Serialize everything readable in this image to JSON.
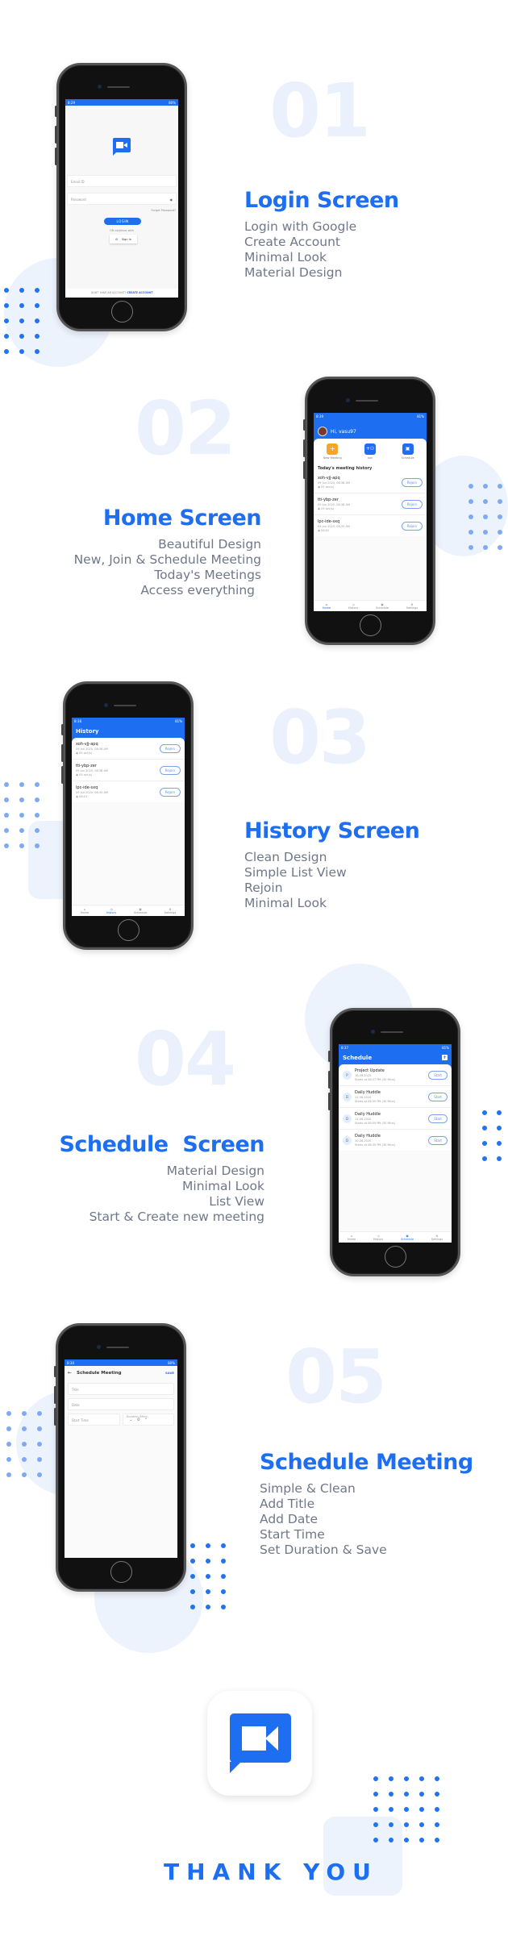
{
  "brand": {
    "accent": "#1d6ef0",
    "soft": "#edf3fd",
    "orange": "#f5a623"
  },
  "sections": [
    {
      "number": "01",
      "title": "Login Screen",
      "features": [
        "Login with Google",
        "Create Account",
        "Minimal Look",
        "Material Design"
      ]
    },
    {
      "number": "02",
      "title": "Home Screen",
      "features": [
        "Beautiful Design",
        "New, Join & Schedule Meeting",
        "Today's Meetings",
        "Access everything"
      ]
    },
    {
      "number": "03",
      "title": "History Screen",
      "features": [
        "Clean Design",
        "Simple List View",
        "Rejoin",
        "Minimal Look"
      ]
    },
    {
      "number": "04",
      "title": "Schedule  Screen",
      "features": [
        "Material Design",
        "Minimal Look",
        "List View",
        "Start & Create new meeting"
      ]
    },
    {
      "number": "05",
      "title": "Schedule Meeting",
      "features": [
        "Simple & Clean",
        "Add Title",
        "Add Date",
        "Start Time",
        "Set Duration & Save"
      ]
    }
  ],
  "login": {
    "status_time": "8:29",
    "status_right": "80% ",
    "email_placeholder": "Email ID",
    "password_placeholder": "Password",
    "forgot": "Forgot Password?",
    "login_button": "LOGIN",
    "or_text": "OR continue with",
    "google_button": "Sign In",
    "footer_text": "DON'T HAVE AN ACCOUNT?",
    "footer_link": "CREATE ACCOUNT",
    "icons": {
      "logo": "video-chat-icon",
      "eye": "eye-icon",
      "google": "google-icon"
    }
  },
  "home": {
    "status_time": "8:39",
    "status_right": "81% ",
    "greeting": "Hi, vasu97",
    "actions": [
      {
        "label": "New Meeting",
        "icon": "plus-box-icon",
        "color": "#f5a623"
      },
      {
        "label": "Join",
        "icon": "join-people-icon",
        "color": "#1d6ef0"
      },
      {
        "label": "Schedule",
        "icon": "calendar-icon",
        "color": "#1d6ef0"
      }
    ],
    "history_title": "Today's meeting history",
    "meetings": [
      {
        "code": "xoh-vjj-apq",
        "date": "09 Jun 2020, 08:38 AM",
        "duration": "05 sec(s)",
        "button": "Rejoin"
      },
      {
        "code": "tti-ybp-zer",
        "date": "09 Jun 2020, 08:38 AM",
        "duration": "05 sec(s)",
        "button": "Rejoin"
      },
      {
        "code": "lpc-ide-sxq",
        "date": "09 Jun 2020, 08:35 AM",
        "duration": "08:01",
        "button": "Rejoin"
      }
    ]
  },
  "history": {
    "status_time": "8:38",
    "status_right": "81% ",
    "title": "History",
    "meetings": [
      {
        "code": "xoh-vjj-apq",
        "date": "09 Jun 2020, 08:38 AM",
        "duration": "05 sec(s)",
        "button": "Rejoin"
      },
      {
        "code": "tti-ybp-zer",
        "date": "09 Jun 2020, 08:38 AM",
        "duration": "05 sec(s)",
        "button": "Rejoin"
      },
      {
        "code": "lpc-ide-sxq",
        "date": "09 Jun 2020, 08:30 AM",
        "duration": "08:01",
        "button": "Rejoin"
      }
    ]
  },
  "nav": {
    "items": [
      "Home",
      "History",
      "Schedule",
      "Settings"
    ]
  },
  "schedule": {
    "status_time": "8:37",
    "status_right": "81% ",
    "title": "Schedule",
    "items": [
      {
        "initial": "P",
        "title": "Project Update",
        "date": "16-06-2020",
        "starts": "Starts at 08:37 PM (30 Mins)",
        "button": "Start"
      },
      {
        "initial": "D",
        "title": "Daily Huddle",
        "date": "12-06-2020",
        "starts": "Starts at 08:35 PM (30 Mins)",
        "button": "Start"
      },
      {
        "initial": "D",
        "title": "Daily Huddle",
        "date": "11-06-2020",
        "starts": "Starts at 08:55 PM (30 Mins)",
        "button": "Start"
      },
      {
        "initial": "D",
        "title": "Daily Huddle",
        "date": "10-06-2020",
        "starts": "Starts at 08:35 PM (30 Mins)",
        "button": "Start"
      }
    ]
  },
  "schedule_meeting": {
    "status_time": "8:30",
    "status_right": "80% ",
    "title": "Schedule Meeting",
    "save": "SAVE",
    "title_placeholder": "Title",
    "date_placeholder": "Date",
    "start_placeholder": "Start Time",
    "duration_label": "Duration (Mins)",
    "duration_value": "0"
  },
  "footer": {
    "thank_you": "THANK YOU"
  }
}
